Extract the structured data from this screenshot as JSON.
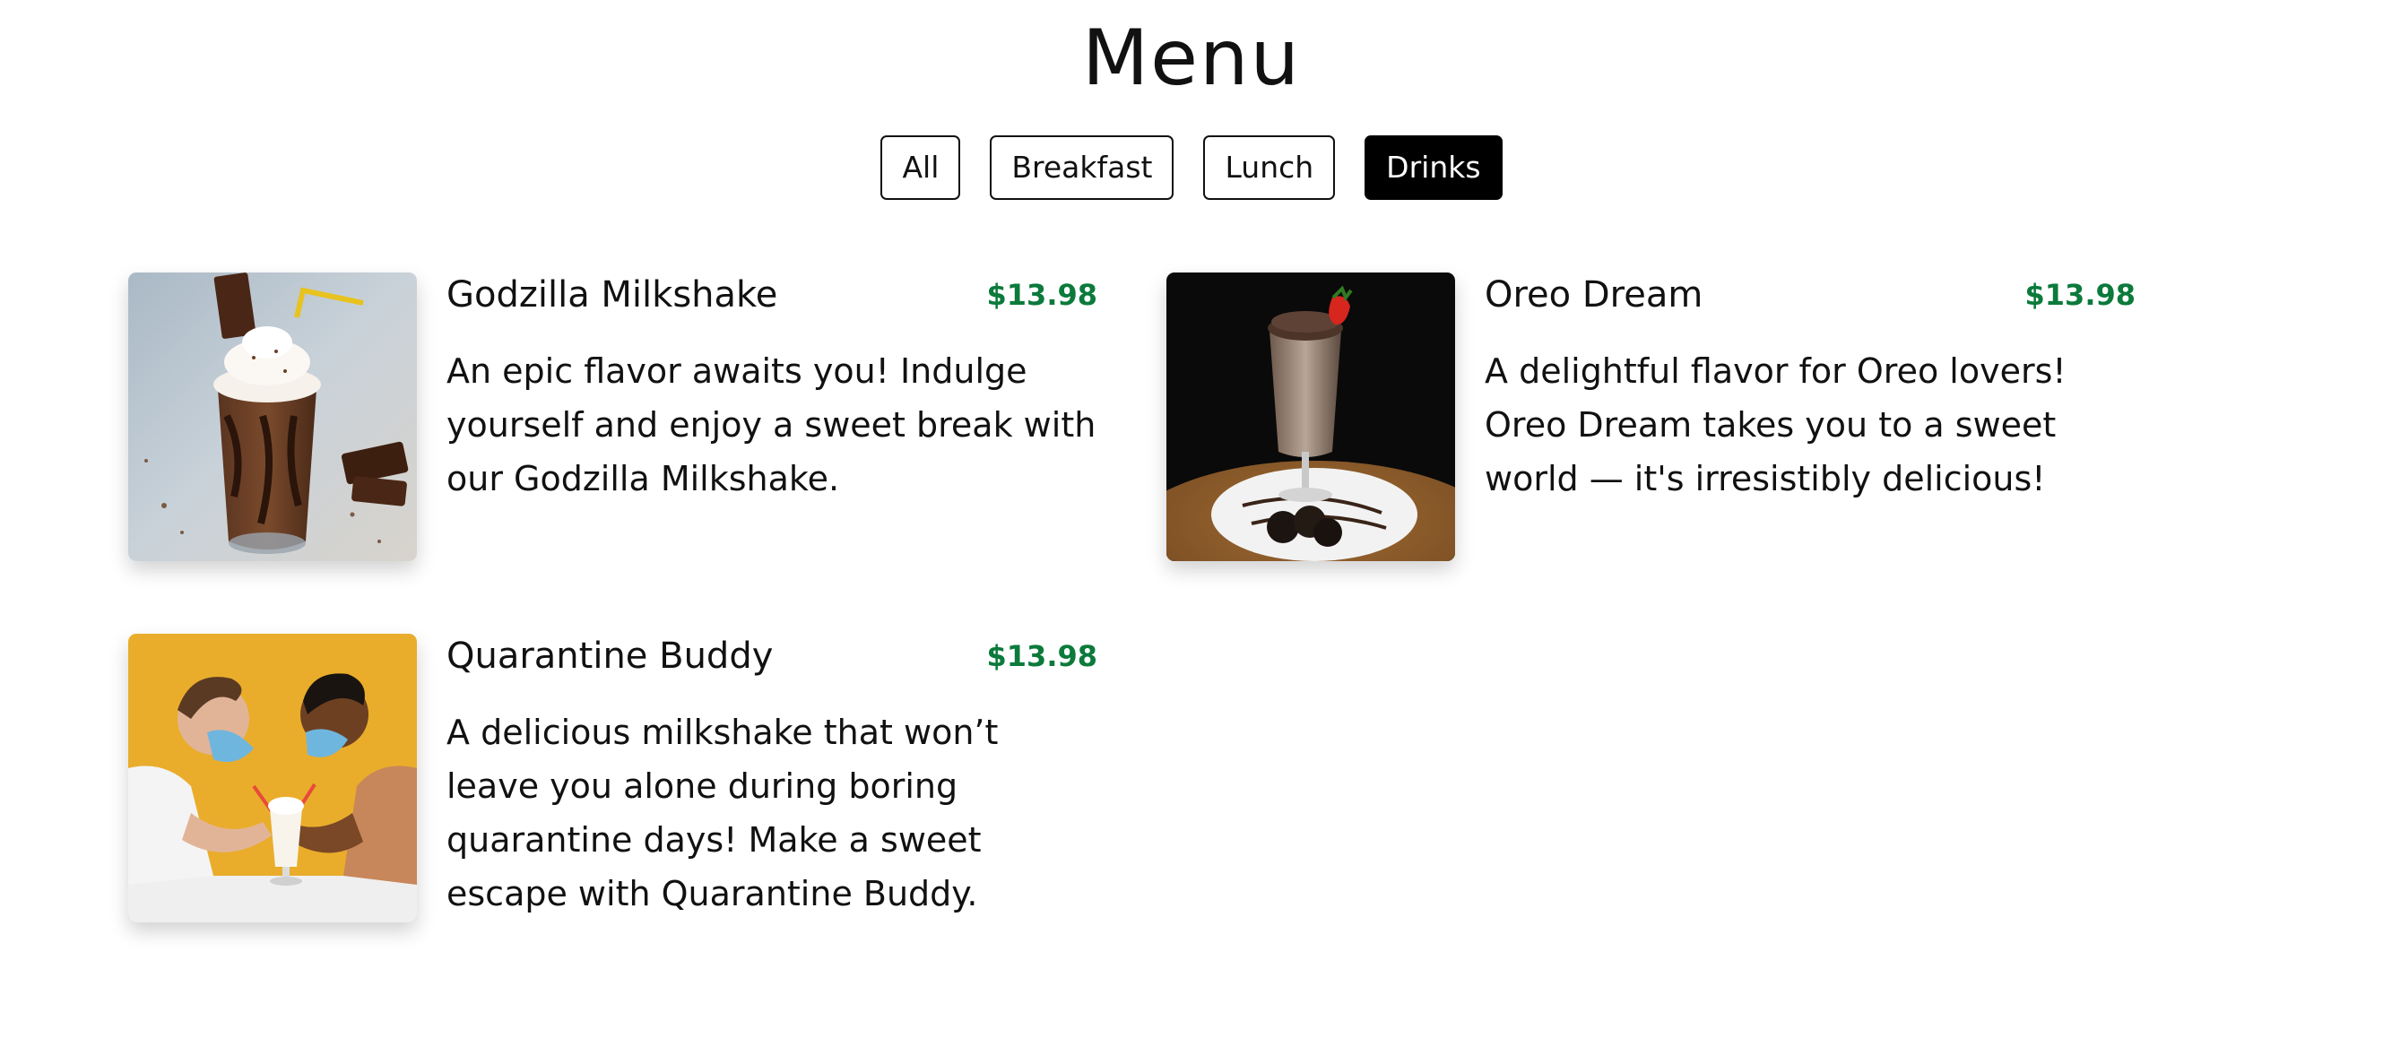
{
  "header": {
    "title": "Menu"
  },
  "filters": [
    {
      "label": "All",
      "active": false
    },
    {
      "label": "Breakfast",
      "active": false
    },
    {
      "label": "Lunch",
      "active": false
    },
    {
      "label": "Drinks",
      "active": true
    }
  ],
  "items": [
    {
      "name": "Godzilla Milkshake",
      "price": "$13.98",
      "description": "An epic flavor awaits you! Indulge yourself and enjoy a sweet break with our Godzilla Milkshake."
    },
    {
      "name": "Oreo Dream",
      "price": "$13.98",
      "description": "A delightful flavor for Oreo lovers! Oreo Dream takes you to a sweet world — it's irresistibly delicious!"
    },
    {
      "name": "Quarantine Buddy",
      "price": "$13.98",
      "description": "A delicious milkshake that won’t leave you alone during boring quarantine days! Make a sweet escape with Quarantine Buddy."
    }
  ],
  "colors": {
    "price": "#0b7a3b",
    "active_filter_bg": "#000000",
    "active_filter_text": "#ffffff"
  }
}
